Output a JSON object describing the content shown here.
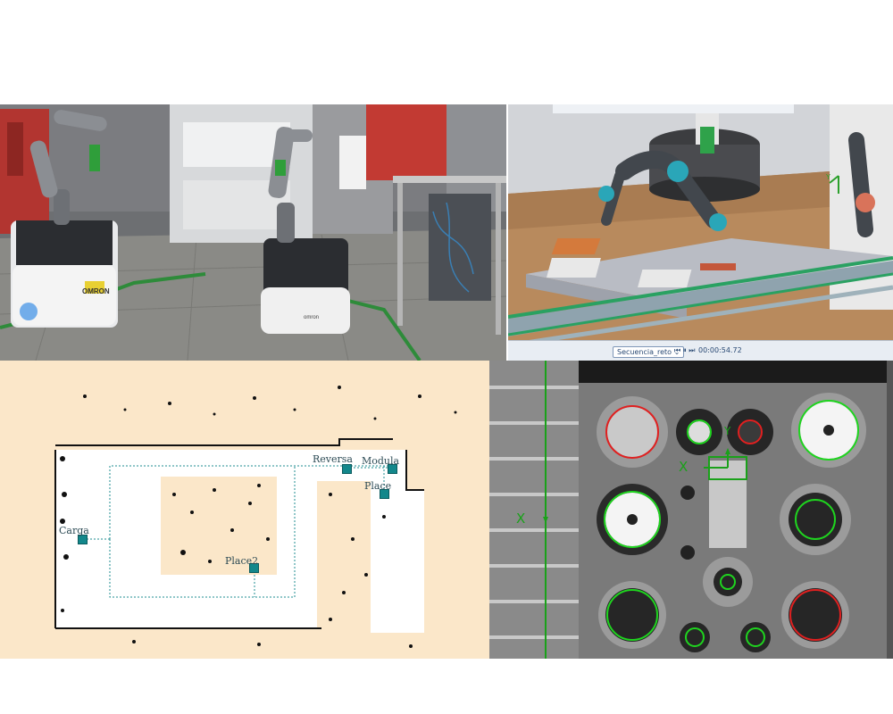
{
  "photo": {
    "robot_brand_left": "OMRON",
    "robot_brand_right": "omron"
  },
  "simulation": {
    "sequence_label": "Secuencia_reto ⌄",
    "controls": "⏮ ⏸ ⏭",
    "time": "00:00:54.72",
    "axis_y": "Y"
  },
  "map": {
    "labels": {
      "reversa": "Reversa",
      "modula": "Modula",
      "place": "Place",
      "carga": "Carga",
      "place2": "Place2"
    },
    "colors": {
      "route": "#1f8d90",
      "node": "#13878b",
      "free_space": "#ffffff",
      "unknown": "#fbe7c9"
    }
  },
  "vision": {
    "axis_x_left": "X",
    "axis_x_inner": "X",
    "axis_y": "Y",
    "colors": {
      "detected": "#1fd41f",
      "rejected": "#e02020"
    }
  }
}
